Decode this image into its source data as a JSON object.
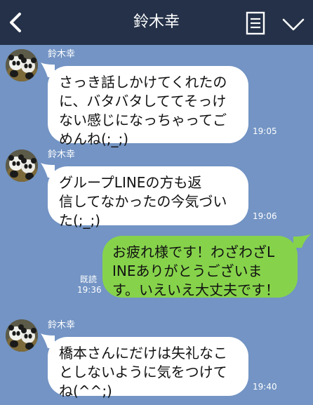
{
  "header": {
    "title": "鈴木幸",
    "back_icon": "chevron-left-icon",
    "menu_icon": "note-list-icon",
    "dropdown_icon": "chevron-down-icon",
    "bar_color": "#243148"
  },
  "chat": {
    "background_color": "#7394c4",
    "incoming_bubble_color": "#ffffff",
    "outgoing_bubble_color": "#86d34b",
    "messages": [
      {
        "direction": "incoming",
        "sender": "鈴木幸",
        "text": "さっき話しかけてくれたの\nに、バタバタしててそっけ\nない感じになっちゃってご\nめんね(;_;)",
        "time": "19:05"
      },
      {
        "direction": "incoming",
        "sender": "鈴木幸",
        "text": "グループLINEの方も返\n信してなかったの今気づい\nた(;_;)",
        "time": "19:06"
      },
      {
        "direction": "outgoing",
        "read_label": "既読",
        "text": "お疲れ様です！わざわざL\nINEありがとうございま\nす。いえいえ大丈夫です！",
        "time": "19:36"
      },
      {
        "direction": "incoming",
        "sender": "鈴木幸",
        "text": "橋本さんにだけは失礼なこ\nとしないように気をつけて\nね(^^;)",
        "time": "19:40"
      }
    ]
  }
}
